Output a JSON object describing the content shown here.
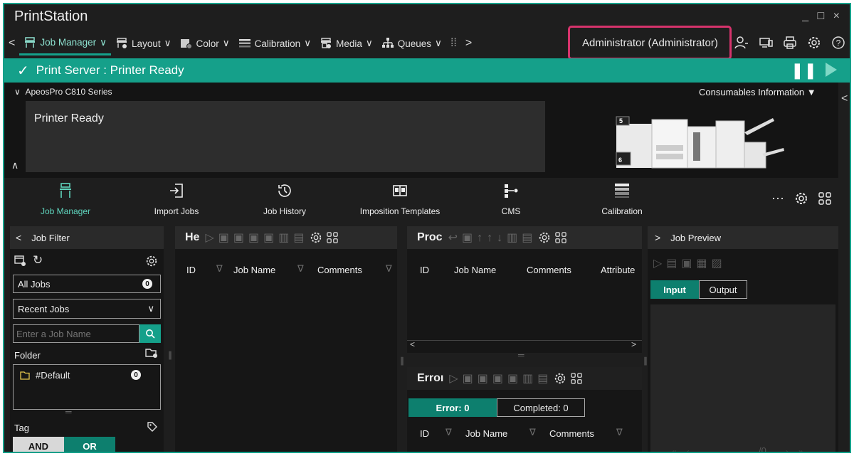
{
  "app": {
    "title": "PrintStation",
    "window_controls": "_ □ ×"
  },
  "menu": {
    "items": [
      {
        "label": "Job Manager",
        "icon": "printer-icon"
      },
      {
        "label": "Layout",
        "icon": "layout-icon"
      },
      {
        "label": "Color",
        "icon": "color-icon"
      },
      {
        "label": "Calibration",
        "icon": "calibration-icon"
      },
      {
        "label": "Media",
        "icon": "media-icon"
      },
      {
        "label": "Queues",
        "icon": "queues-icon"
      }
    ],
    "user": "Administrator (Administrator)"
  },
  "status": {
    "text": "Print Server : Printer Ready"
  },
  "printer": {
    "name": "ApeosPro C810 Series",
    "message": "Printer Ready",
    "consumables_label": "Consumables Information",
    "tray_labels": [
      "5",
      "6"
    ]
  },
  "toolbar": {
    "items": [
      {
        "label": "Job Manager",
        "icon": "job-manager-icon"
      },
      {
        "label": "Import Jobs",
        "icon": "import-icon"
      },
      {
        "label": "Job History",
        "icon": "history-icon"
      },
      {
        "label": "Imposition Templates",
        "icon": "book-icon"
      },
      {
        "label": "CMS",
        "icon": "cms-icon"
      },
      {
        "label": "Calibration",
        "icon": "calibration-bars-icon"
      }
    ],
    "more": "···"
  },
  "job_filter": {
    "title": "Job Filter",
    "all_jobs_label": "All Jobs",
    "all_jobs_count": "0",
    "recent_jobs_label": "Recent Jobs",
    "search_placeholder": "Enter a Job Name",
    "folder_label": "Folder",
    "folders": [
      {
        "name": "#Default",
        "count": "0"
      }
    ],
    "tag_label": "Tag",
    "tag_and": "AND",
    "tag_or": "OR"
  },
  "hold_panel": {
    "title": "He",
    "columns": [
      "ID",
      "Job Name",
      "Comments"
    ]
  },
  "process_panel": {
    "title": "Proc",
    "columns": [
      "ID",
      "Job Name",
      "Comments",
      "Attribute"
    ]
  },
  "error_panel": {
    "title": "Erroı",
    "tab_error": "Error: 0",
    "tab_completed": "Completed: 0",
    "columns": [
      "ID",
      "Job Name",
      "Comments"
    ]
  },
  "preview": {
    "title": "Job Preview",
    "tab_input": "Input",
    "tab_output": "Output",
    "page_count": "/0"
  },
  "colors": {
    "accent": "#15a08a",
    "highlight_box": "#d6336c"
  }
}
